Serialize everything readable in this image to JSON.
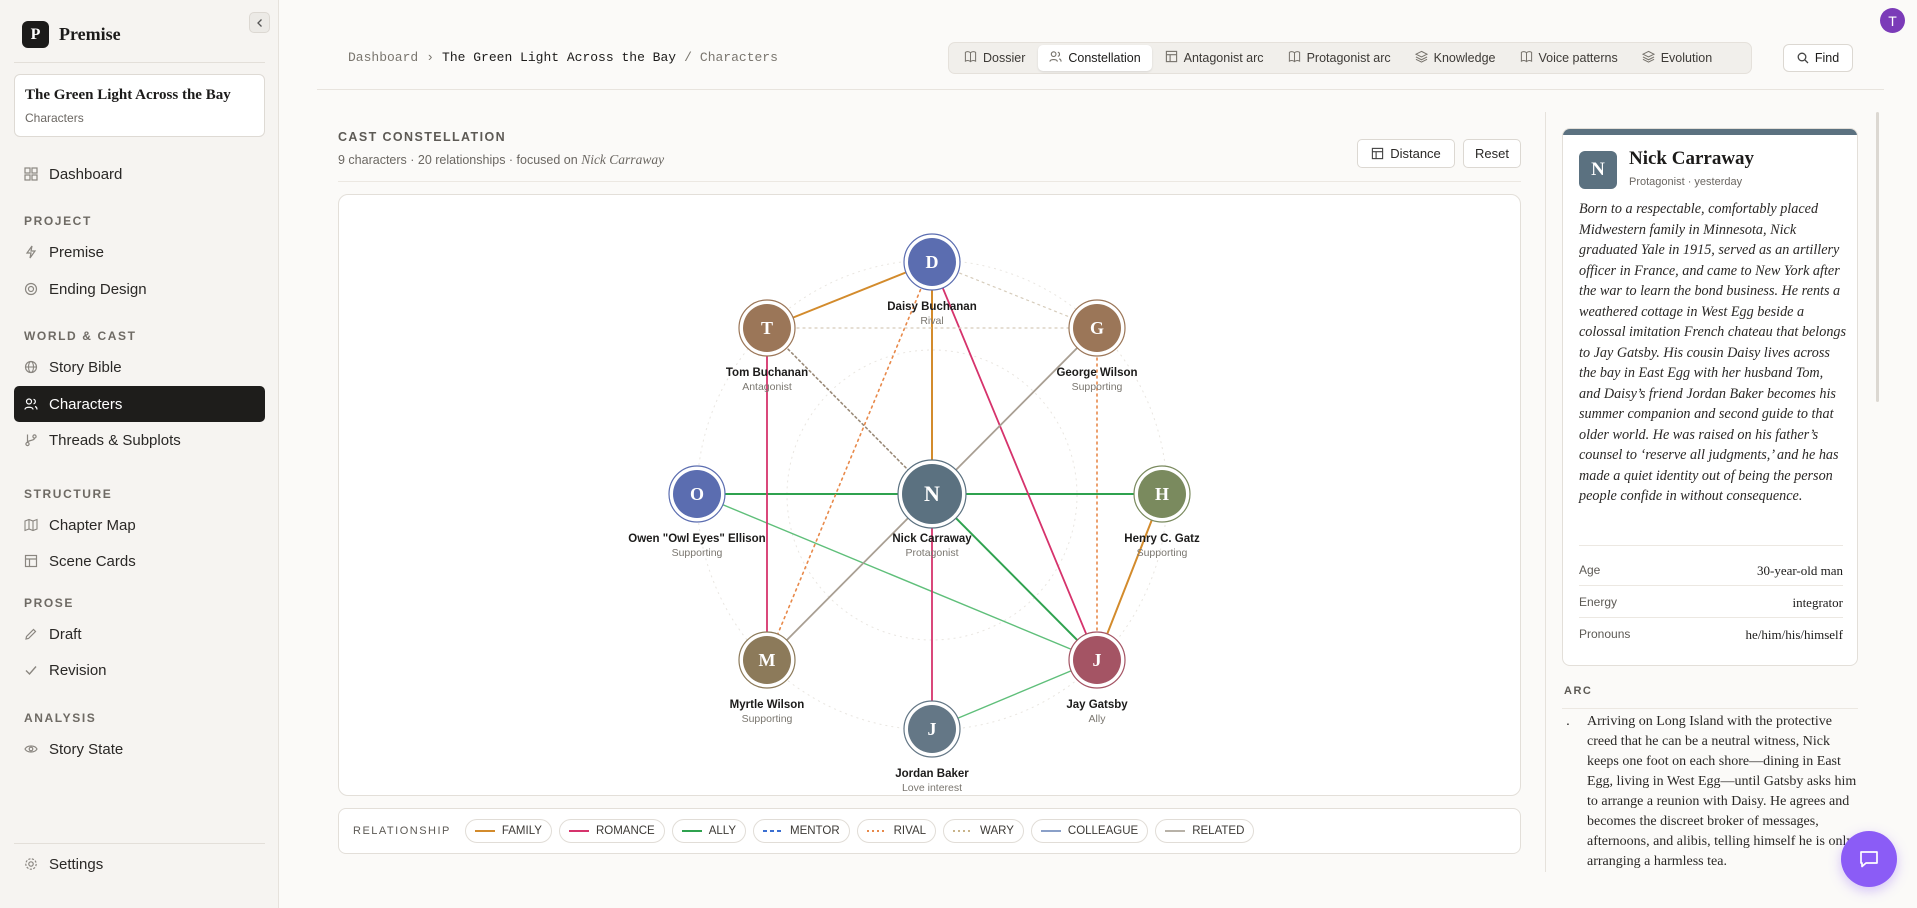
{
  "app": {
    "name": "Premise",
    "logo_letter": "P"
  },
  "project": {
    "title": "The Green Light Across the Bay",
    "section": "Characters"
  },
  "sidebar": {
    "top_items": [
      {
        "label": "Dashboard",
        "icon": "grid-icon"
      }
    ],
    "sections": [
      {
        "title": "PROJECT",
        "items": [
          {
            "label": "Premise",
            "icon": "bolt-icon"
          },
          {
            "label": "Ending Design",
            "icon": "target-icon"
          }
        ]
      },
      {
        "title": "WORLD & CAST",
        "items": [
          {
            "label": "Story Bible",
            "icon": "globe-icon"
          },
          {
            "label": "Characters",
            "icon": "users-icon",
            "active": true
          },
          {
            "label": "Threads & Subplots",
            "icon": "branch-icon"
          }
        ]
      },
      {
        "title": "STRUCTURE",
        "items": [
          {
            "label": "Chapter Map",
            "icon": "map-icon"
          },
          {
            "label": "Scene Cards",
            "icon": "layout-icon"
          }
        ]
      },
      {
        "title": "PROSE",
        "items": [
          {
            "label": "Draft",
            "icon": "pen-icon"
          },
          {
            "label": "Revision",
            "icon": "check-icon"
          }
        ]
      },
      {
        "title": "ANALYSIS",
        "items": [
          {
            "label": "Story State",
            "icon": "eye-icon"
          }
        ]
      }
    ],
    "settings_label": "Settings"
  },
  "header": {
    "breadcrumb": {
      "root": "Dashboard",
      "sep1": "›",
      "project": "The Green Light Across the Bay",
      "sep2": "/",
      "current": "Characters"
    },
    "tabs": [
      {
        "label": "Dossier",
        "icon": "book-icon"
      },
      {
        "label": "Constellation",
        "icon": "users-icon",
        "active": true
      },
      {
        "label": "Antagonist arc",
        "icon": "layout-icon"
      },
      {
        "label": "Protagonist arc",
        "icon": "book-icon"
      },
      {
        "label": "Knowledge",
        "icon": "layers-icon"
      },
      {
        "label": "Voice patterns",
        "icon": "book-icon"
      },
      {
        "label": "Evolution",
        "icon": "layers-icon"
      }
    ],
    "find_label": "Find",
    "avatar_letter": "T"
  },
  "constellation": {
    "title": "CAST CONSTELLATION",
    "subtitle_prefix": "9 characters · 20 relationships · focused on ",
    "focus_name": "Nick Carraway",
    "distance_label": "Distance",
    "reset_label": "Reset"
  },
  "characters": [
    {
      "id": "D",
      "name": "Daisy Buchanan",
      "role": "Rival",
      "color": "#5b6db0"
    },
    {
      "id": "T",
      "name": "Tom Buchanan",
      "role": "Antagonist",
      "color": "#9b7658"
    },
    {
      "id": "G",
      "name": "George Wilson",
      "role": "Supporting",
      "color": "#9b7658"
    },
    {
      "id": "O",
      "name": "Owen \"Owl Eyes\" Ellison",
      "role": "Supporting",
      "color": "#5b6db0"
    },
    {
      "id": "N",
      "name": "Nick Carraway",
      "role": "Protagonist",
      "color": "#5b7180"
    },
    {
      "id": "H",
      "name": "Henry C. Gatz",
      "role": "Supporting",
      "color": "#7a8a5e"
    },
    {
      "id": "M",
      "name": "Myrtle Wilson",
      "role": "Supporting",
      "color": "#8c7a5a"
    },
    {
      "id": "J",
      "name": "Jay Gatsby",
      "role": "Ally",
      "color": "#a45464"
    },
    {
      "id": "J",
      "name": "Jordan Baker",
      "role": "Love interest",
      "color": "#647786"
    }
  ],
  "relationships": [
    {
      "from": 4,
      "to": 0,
      "type": "family"
    },
    {
      "from": 1,
      "to": 0,
      "type": "family"
    },
    {
      "from": 5,
      "to": 7,
      "type": "family"
    },
    {
      "from": 4,
      "to": 3,
      "type": "ally"
    },
    {
      "from": 4,
      "to": 5,
      "type": "ally"
    },
    {
      "from": 4,
      "to": 7,
      "type": "ally"
    },
    {
      "from": 3,
      "to": 7,
      "type": "ally2"
    },
    {
      "from": 8,
      "to": 7,
      "type": "ally2"
    },
    {
      "from": 4,
      "to": 8,
      "type": "romance"
    },
    {
      "from": 0,
      "to": 7,
      "type": "romance"
    },
    {
      "from": 1,
      "to": 6,
      "type": "romance"
    },
    {
      "from": 4,
      "to": 2,
      "type": "related"
    },
    {
      "from": 4,
      "to": 6,
      "type": "related"
    },
    {
      "from": 0,
      "to": 6,
      "type": "rival"
    },
    {
      "from": 2,
      "to": 7,
      "type": "rival"
    },
    {
      "from": 1,
      "to": 4,
      "type": "wary_dark"
    },
    {
      "from": 1,
      "to": 2,
      "type": "wary"
    },
    {
      "from": 0,
      "to": 2,
      "type": "wary"
    }
  ],
  "legend": {
    "title": "RELATIONSHIP",
    "items": [
      {
        "label": "FAMILY",
        "color": "#d38b2c",
        "style": "solid"
      },
      {
        "label": "ROMANCE",
        "color": "#d6336c",
        "style": "solid"
      },
      {
        "label": "ALLY",
        "color": "#2fa24f",
        "style": "solid"
      },
      {
        "label": "MENTOR",
        "color": "#3b6fd1",
        "style": "dashed"
      },
      {
        "label": "RIVAL",
        "color": "#e8894a",
        "style": "dotted"
      },
      {
        "label": "WARY",
        "color": "#c9b48a",
        "style": "dotted"
      },
      {
        "label": "COLLEAGUE",
        "color": "#8aa0c8",
        "style": "solid"
      },
      {
        "label": "RELATED",
        "color": "#b8b2a8",
        "style": "solid"
      }
    ]
  },
  "profile": {
    "avatar_letter": "N",
    "name": "Nick Carraway",
    "meta": "Protagonist · yesterday",
    "bio": "Born to a respectable, comfortably placed Midwestern family in Minnesota, Nick graduated Yale in 1915, served as an artillery officer in France, and came to New York after the war to learn the bond business. He rents a weathered cottage in West Egg beside a colossal imitation French chateau that belongs to Jay Gatsby. His cousin Daisy lives across the bay in East Egg with her husband Tom, and Daisy’s friend Jordan Baker becomes his summer companion and second guide to that older world. He was raised on his father’s counsel to ‘reserve all judgments,’ and he has made a quiet identity out of being the person people confide in without consequence.",
    "fields": [
      {
        "key": "Age",
        "value": "30-year-old man"
      },
      {
        "key": "Energy",
        "value": "integrator"
      },
      {
        "key": "Pronouns",
        "value": "he/him/his/himself"
      }
    ],
    "arc_title": "ARC",
    "arc_bullet": ".",
    "arc_text": "Arriving on Long Island with the protective creed that he can be a neutral witness, Nick keeps one foot on each shore—dining in East Egg, living in West Egg—until Gatsby asks him to arrange a reunion with Daisy. He agrees and becomes the discreet broker of messages, afternoons, and alibis, telling himself he is only arranging a harmless tea."
  }
}
